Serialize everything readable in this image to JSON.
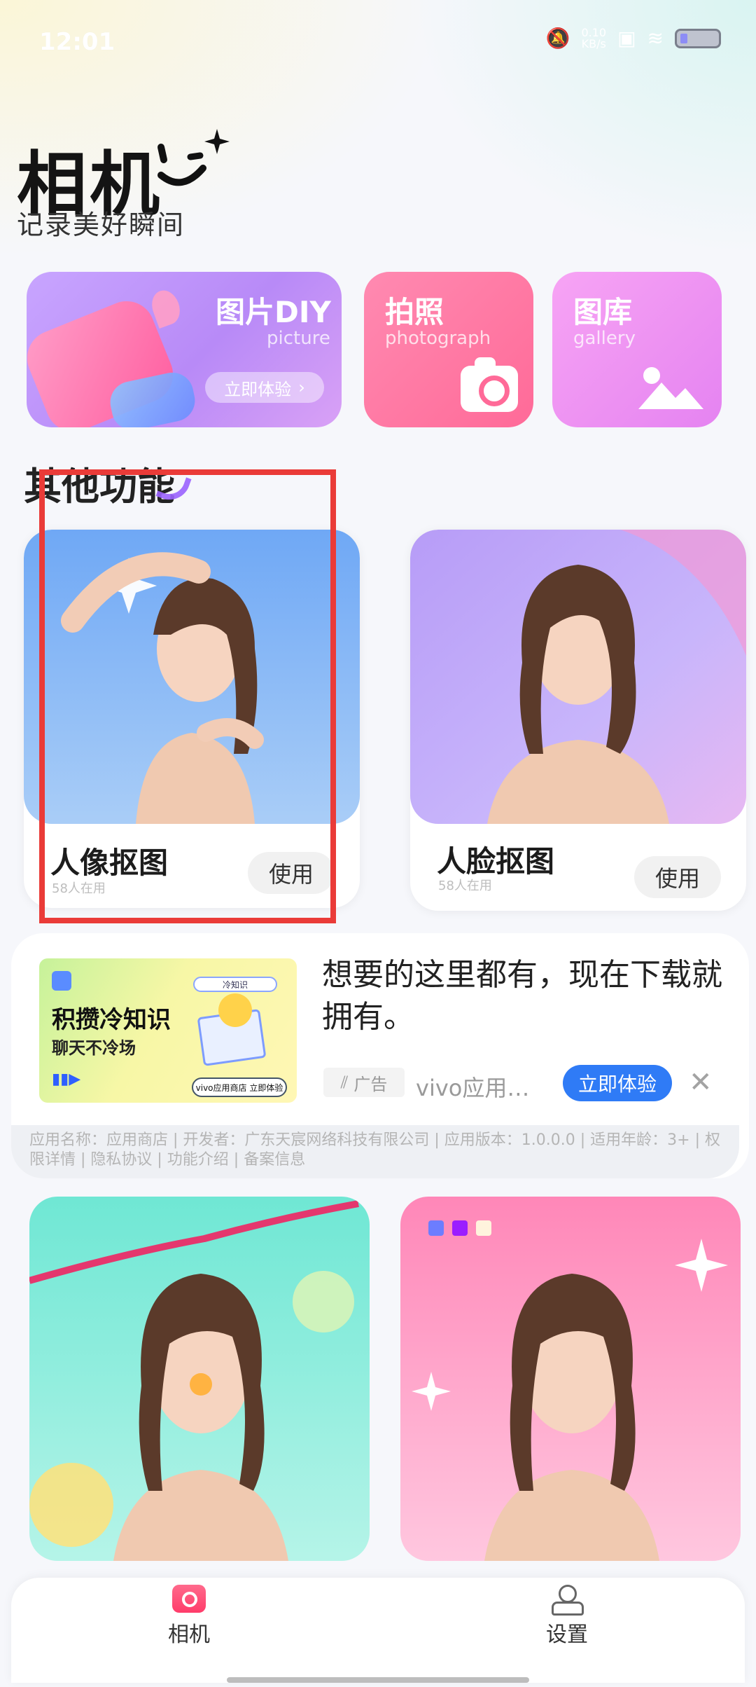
{
  "status_bar": {
    "time": "12:01",
    "speed_value": "0.10",
    "speed_unit": "KB/s"
  },
  "header": {
    "title": "相机",
    "subtitle": "记录美好瞬间"
  },
  "features": [
    {
      "title": "图片DIY",
      "subtitle": "picture",
      "button": "立即体验"
    },
    {
      "title": "拍照",
      "subtitle": "photograph"
    },
    {
      "title": "图库",
      "subtitle": "gallery"
    }
  ],
  "section": {
    "title": "其他功能"
  },
  "tools": [
    {
      "name": "人像抠图",
      "count": "58人在用",
      "button": "使用"
    },
    {
      "name": "人脸抠图",
      "count": "58人在用",
      "button": "使用"
    }
  ],
  "ad": {
    "thumb_title": "积攒冷知识",
    "thumb_subtitle": "聊天不冷场",
    "thumb_search": "冷知识",
    "thumb_pill": "vivo应用商店 立即体验",
    "text": "想要的这里都有，现在下载就拥有。",
    "tag": "广告",
    "app_name": "vivo应用…",
    "cta": "立即体验",
    "footer": "应用名称：应用商店 | 开发者：广东天宸网络科技有限公司 | 应用版本：1.0.0.0 | 适用年龄：3+ | 权限详情 | 隐私协议 | 功能介绍 | 备案信息"
  },
  "nav": [
    {
      "label": "相机"
    },
    {
      "label": "设置"
    }
  ],
  "colors": {
    "accent_pink": "#ff6a98",
    "cta_blue": "#2f7bf6",
    "highlight_red": "#ea3b38"
  }
}
